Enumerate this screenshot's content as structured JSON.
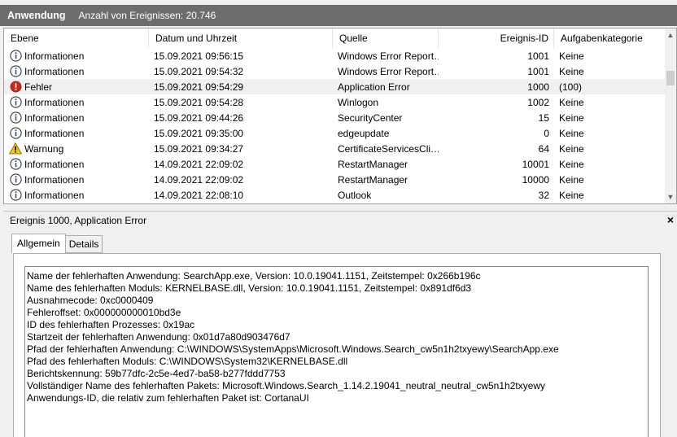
{
  "header": {
    "title": "Anwendung",
    "count_text": "Anzahl von Ereignissen: 20.746"
  },
  "columns": {
    "level": "Ebene",
    "date": "Datum und Uhrzeit",
    "source": "Quelle",
    "event_id": "Ereignis-ID",
    "category": "Aufgabenkategorie"
  },
  "events": [
    {
      "level": "Informationen",
      "icon": "info-icon",
      "date": "15.09.2021 09:56:15",
      "source": "Windows Error Report…",
      "event_id": "1001",
      "category": "Keine"
    },
    {
      "level": "Informationen",
      "icon": "info-icon",
      "date": "15.09.2021 09:54:32",
      "source": "Windows Error Report…",
      "event_id": "1001",
      "category": "Keine"
    },
    {
      "level": "Fehler",
      "icon": "error-icon",
      "date": "15.09.2021 09:54:29",
      "source": "Application Error",
      "event_id": "1000",
      "category": "(100)"
    },
    {
      "level": "Informationen",
      "icon": "info-icon",
      "date": "15.09.2021 09:54:28",
      "source": "Winlogon",
      "event_id": "1002",
      "category": "Keine"
    },
    {
      "level": "Informationen",
      "icon": "info-icon",
      "date": "15.09.2021 09:44:26",
      "source": "SecurityCenter",
      "event_id": "15",
      "category": "Keine"
    },
    {
      "level": "Informationen",
      "icon": "info-icon",
      "date": "15.09.2021 09:35:00",
      "source": "edgeupdate",
      "event_id": "0",
      "category": "Keine"
    },
    {
      "level": "Warnung",
      "icon": "warning-icon",
      "date": "15.09.2021 09:34:27",
      "source": "CertificateServicesCli…",
      "event_id": "64",
      "category": "Keine"
    },
    {
      "level": "Informationen",
      "icon": "info-icon",
      "date": "14.09.2021 22:09:02",
      "source": "RestartManager",
      "event_id": "10001",
      "category": "Keine"
    },
    {
      "level": "Informationen",
      "icon": "info-icon",
      "date": "14.09.2021 22:09:02",
      "source": "RestartManager",
      "event_id": "10000",
      "category": "Keine"
    },
    {
      "level": "Informationen",
      "icon": "info-icon",
      "date": "14.09.2021 22:08:10",
      "source": "Outlook",
      "event_id": "32",
      "category": "Keine"
    }
  ],
  "selected_index": 2,
  "detail": {
    "title": "Ereignis 1000, Application Error",
    "close_label": "×",
    "tabs": [
      "Allgemein",
      "Details"
    ],
    "lines": [
      "Name der fehlerhaften Anwendung: SearchApp.exe, Version: 10.0.19041.1151, Zeitstempel: 0x266b196c",
      "Name des fehlerhaften Moduls: KERNELBASE.dll, Version: 10.0.19041.1151, Zeitstempel: 0x891df6d3",
      "Ausnahmecode: 0xc0000409",
      "Fehleroffset: 0x000000000010bd3e",
      "ID des fehlerhaften Prozesses: 0x19ac",
      "Startzeit der fehlerhaften Anwendung: 0x01d7a80d903476d7",
      "Pfad der fehlerhaften Anwendung: C:\\WINDOWS\\SystemApps\\Microsoft.Windows.Search_cw5n1h2txyewy\\SearchApp.exe",
      "Pfad des fehlerhaften Moduls: C:\\WINDOWS\\System32\\KERNELBASE.dll",
      "Berichtskennung: 59b77dfc-2c5e-4ed7-ba58-b277fddd7753",
      "Vollständiger Name des fehlerhaften Pakets: Microsoft.Windows.Search_1.14.2.19041_neutral_neutral_cw5n1h2txyewy",
      "Anwendungs-ID, die relativ zum fehlerhaften Paket ist: CortanaUI"
    ]
  },
  "scroll": {
    "up": "▲",
    "down": "▼"
  }
}
